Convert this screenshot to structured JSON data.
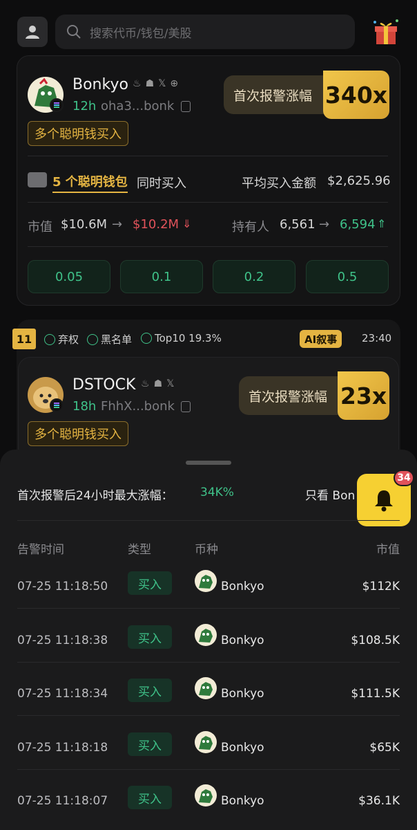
{
  "search": {
    "placeholder": "搜索代币/钱包/美股"
  },
  "card1": {
    "name": "Bonkyo",
    "age": "12h",
    "address": "oha3...bonk",
    "tag": "多个聪明钱买入",
    "alert_label": "首次报警涨幅",
    "multiplier": "340x",
    "smart_wallets": "5 个聪明钱包",
    "smart_wallets_suffix": "同时买入",
    "avg_buy_label": "平均买入金额",
    "avg_buy_value": "$2,625.96",
    "mcap_label": "市值",
    "mcap_from": "$10.6M",
    "mcap_to": "$10.2M",
    "holders_label": "持有人",
    "holders_from": "6,561",
    "holders_to": "6,594",
    "buy_amounts": [
      "0.05",
      "0.1",
      "0.2",
      "0.5"
    ]
  },
  "card2": {
    "rank": "11",
    "checks": [
      "弃权",
      "黑名单",
      "Top10 19.3%"
    ],
    "ai_tag": "AI叙事",
    "time": "23:40",
    "name": "DSTOCK",
    "age": "18h",
    "address": "FhhX...bonk",
    "alert_label": "首次报警涨幅",
    "multiplier": "23x",
    "tag": "多个聪明钱买入"
  },
  "sheet": {
    "title": "首次报警后24小时最大涨幅：",
    "max_gain": "34K%",
    "filter": "只看 Bon",
    "bell_count": "34",
    "headers": [
      "告警时间",
      "类型",
      "币种",
      "市值"
    ],
    "rows": [
      {
        "time": "07-25 11:18:50",
        "type": "买入",
        "coin": "Bonkyo",
        "mcap": "$112K"
      },
      {
        "time": "07-25 11:18:38",
        "type": "买入",
        "coin": "Bonkyo",
        "mcap": "$108.5K"
      },
      {
        "time": "07-25 11:18:34",
        "type": "买入",
        "coin": "Bonkyo",
        "mcap": "$111.5K"
      },
      {
        "time": "07-25 11:18:18",
        "type": "买入",
        "coin": "Bonkyo",
        "mcap": "$65K"
      },
      {
        "time": "07-25 11:18:07",
        "type": "买入",
        "coin": "Bonkyo",
        "mcap": "$36.1K"
      }
    ]
  },
  "colors": {
    "accent_gold": "#e4b442",
    "up_green": "#3fc289",
    "down_red": "#e0525a",
    "bell_yellow": "#f6d032"
  }
}
